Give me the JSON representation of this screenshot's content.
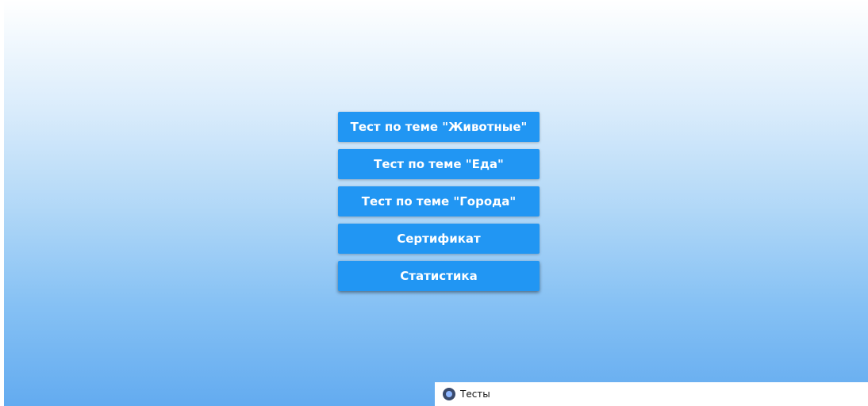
{
  "menu": {
    "buttons": [
      {
        "label": "Тест по теме \"Животные\""
      },
      {
        "label": "Тест по теме \"Еда\""
      },
      {
        "label": "Тест по теме \"Города\""
      },
      {
        "label": "Сертификат"
      },
      {
        "label": "Статистика"
      }
    ]
  },
  "taskbar": {
    "app_label": "Тесты",
    "icon": "app-icon"
  },
  "colors": {
    "button": "#2196f3",
    "background_top": "#ffffff",
    "background_bottom": "#63abf0"
  }
}
